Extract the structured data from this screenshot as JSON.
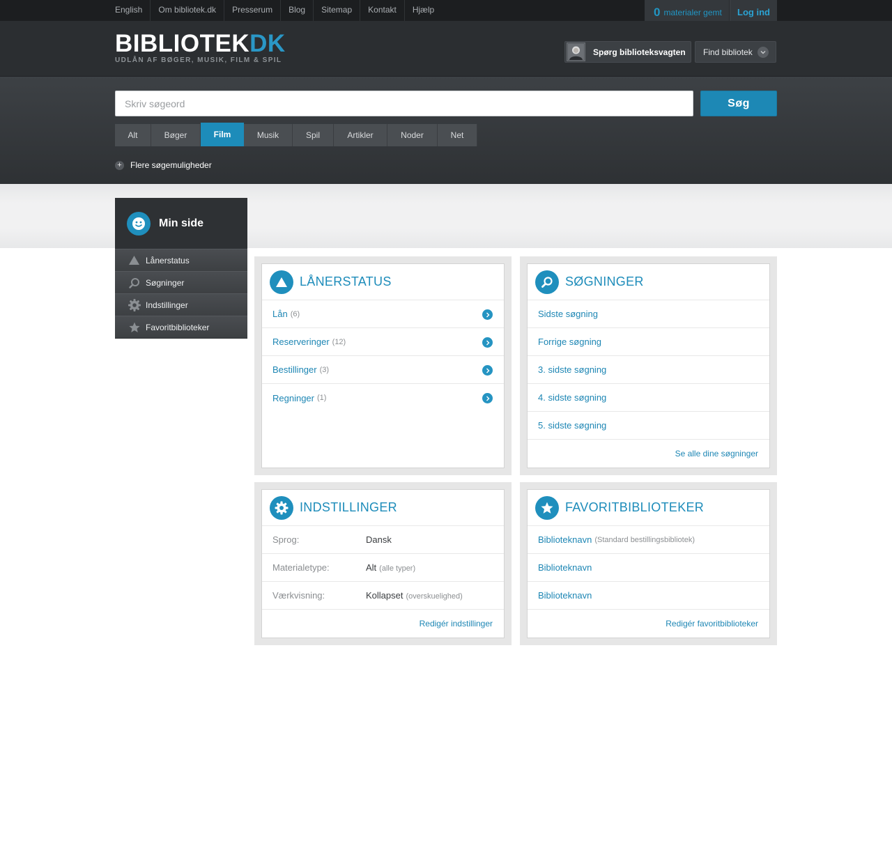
{
  "topbar": {
    "links": [
      "English",
      "Om bibliotek.dk",
      "Presserum",
      "Blog",
      "Sitemap",
      "Kontakt",
      "Hjælp"
    ],
    "saved_count": "0",
    "saved_label": "materialer gemt",
    "login_label": "Log ind"
  },
  "header": {
    "logo_main": "BIBLIOTEK",
    "logo_accent": "DK",
    "logo_tagline": "UDLÅN AF BØGER, MUSIK, FILM & SPIL",
    "ask_label": "Spørg biblioteksvagten",
    "find_label": "Find bibliotek"
  },
  "search": {
    "placeholder": "Skriv søgeord",
    "button_label": "Søg",
    "tabs": [
      "Alt",
      "Bøger",
      "Film",
      "Musik",
      "Spil",
      "Artikler",
      "Noder",
      "Net"
    ],
    "active_tab": "Film",
    "more_options_label": "Flere søgemuligheder"
  },
  "sidebar": {
    "title": "Min side",
    "items": [
      {
        "label": "Lånerstatus",
        "icon": "triangle-icon"
      },
      {
        "label": "Søgninger",
        "icon": "search-icon"
      },
      {
        "label": "Indstillinger",
        "icon": "gear-icon"
      },
      {
        "label": "Favoritbiblioteker",
        "icon": "star-icon"
      }
    ]
  },
  "panels": {
    "lanerstatus": {
      "title": "LÅNERSTATUS",
      "rows": [
        {
          "label": "Lån",
          "count": "(6)"
        },
        {
          "label": "Reserveringer",
          "count": "(12)"
        },
        {
          "label": "Bestillinger",
          "count": "(3)"
        },
        {
          "label": "Regninger",
          "count": "(1)"
        }
      ]
    },
    "sogninger": {
      "title": "SØGNINGER",
      "rows": [
        "Sidste søgning",
        "Forrige søgning",
        "3. sidste søgning",
        "4. sidste søgning",
        "5. sidste søgning"
      ],
      "footer": "Se alle dine søgninger"
    },
    "indstillinger": {
      "title": "INDSTILLINGER",
      "rows": [
        {
          "key": "Sprog:",
          "value": "Dansk",
          "sub": ""
        },
        {
          "key": "Materialetype:",
          "value": "Alt",
          "sub": "(alle typer)"
        },
        {
          "key": "Værkvisning:",
          "value": "Kollapset",
          "sub": "(overskuelighed)"
        }
      ],
      "footer": "Redigér indstillinger"
    },
    "favoritbiblioteker": {
      "title": "FAVORITBIBLIOTEKER",
      "rows": [
        {
          "label": "Biblioteknavn",
          "sub": "(Standard bestillingsbibliotek)"
        },
        {
          "label": "Biblioteknavn",
          "sub": ""
        },
        {
          "label": "Biblioteknavn",
          "sub": ""
        }
      ],
      "footer": "Redigér favoritbiblioteker"
    }
  },
  "colors": {
    "accent": "#1d8cba",
    "dark_bar": "#1c1e20",
    "header_bg": "#2b2e31"
  }
}
